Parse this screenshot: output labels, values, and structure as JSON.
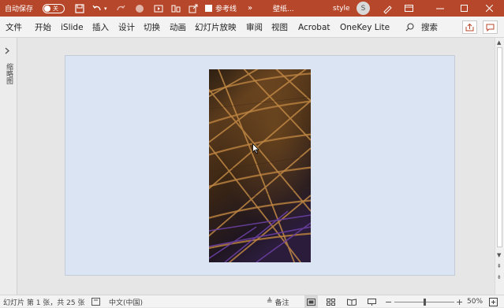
{
  "titlebar": {
    "autosave_label": "自动保存",
    "autosave_state": "关",
    "reference_line_label": "参考线",
    "more_glyph": "»",
    "file_name": "壁纸...",
    "user_name": "style",
    "avatar_letter": "S"
  },
  "ribbon": {
    "tabs": [
      "文件",
      "开始",
      "iSlide",
      "插入",
      "设计",
      "切换",
      "动画",
      "幻灯片放映",
      "审阅",
      "视图",
      "Acrobat",
      "OneKey Lite"
    ],
    "search_label": "搜索"
  },
  "left_pane": {
    "label": "缩略图"
  },
  "status": {
    "slide_info": "幻灯片 第 1 张，共 25 张",
    "language": "中文(中国)",
    "notes_label": "备注",
    "zoom_minus": "−",
    "zoom_plus": "+",
    "zoom_percent": "50%",
    "zoom_level": 0.5
  },
  "colors": {
    "titlebar_bg": "#b7472a",
    "slide_bg": "#dbe4f2",
    "photo_bg": "#3a2616"
  }
}
